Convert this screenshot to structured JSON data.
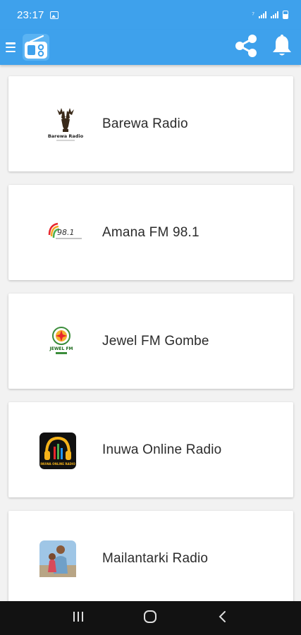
{
  "status_bar": {
    "time": "23:17",
    "icons": [
      "image-icon",
      "wifi-question-icon",
      "signal-icon",
      "signal-icon",
      "battery-icon"
    ]
  },
  "app_bar": {
    "menu_icon": "hamburger-menu-icon",
    "logo_icon": "radio-logo-icon",
    "share_icon": "share-icon",
    "notification_icon": "bell-icon",
    "color": "#3ea1ec"
  },
  "stations": [
    {
      "name": "Barewa Radio",
      "logo": "deer-logo",
      "logo_text": "Barewa Radio"
    },
    {
      "name": "Amana FM 98.1",
      "logo": "amana-logo",
      "logo_text": "98.1"
    },
    {
      "name": "Jewel FM Gombe",
      "logo": "jewel-fm-logo",
      "logo_text": "JEWEL FM"
    },
    {
      "name": "Inuwa Online Radio",
      "logo": "headphones-logo",
      "logo_text": "INUWA ONLINE RADIO"
    },
    {
      "name": "Mailantarki Radio",
      "logo": "person-photo-logo",
      "logo_text": ""
    }
  ],
  "nav_bar": {
    "recents_icon": "recents-icon",
    "home_icon": "home-icon",
    "back_icon": "back-icon"
  }
}
